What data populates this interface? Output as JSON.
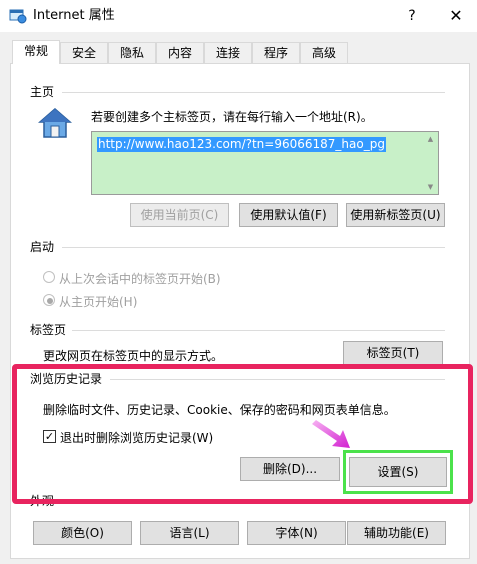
{
  "window": {
    "title": "Internet 属性",
    "help": "?",
    "close": "✕"
  },
  "tabs": [
    "常规",
    "安全",
    "隐私",
    "内容",
    "连接",
    "程序",
    "高级"
  ],
  "home": {
    "label": "主页",
    "instruction": "若要创建多个主标签页，请在每行输入一个地址(R)。",
    "url": "http://www.hao123.com/?tn=96066187_hao_pg",
    "btn_current": "使用当前页(C)",
    "btn_default": "使用默认值(F)",
    "btn_newtab": "使用新标签页(U)"
  },
  "startup": {
    "label": "启动",
    "opt_last_session": "从上次会话中的标签页开始(B)",
    "opt_homepage": "从主页开始(H)",
    "selected": "opt_homepage"
  },
  "tabs_section": {
    "label": "标签页",
    "desc": "更改网页在标签页中的显示方式。",
    "btn": "标签页(T)"
  },
  "history": {
    "label": "浏览历史记录",
    "desc": "删除临时文件、历史记录、Cookie、保存的密码和网页表单信息。",
    "checkbox_label": "退出时删除浏览历史记录(W)",
    "checkbox_checked": true,
    "btn_delete": "删除(D)...",
    "btn_settings": "设置(S)"
  },
  "appearance": {
    "label": "外观",
    "btn_colors": "颜色(O)",
    "btn_languages": "语言(L)",
    "btn_fonts": "字体(N)",
    "btn_accessibility": "辅助功能(E)"
  },
  "colors": {
    "highlight_frame": "#e8245f",
    "settings_frame": "#4be24b",
    "arrow": "#e040e0",
    "url_bg": "#c8f0c8",
    "selection": "#3399ff"
  }
}
